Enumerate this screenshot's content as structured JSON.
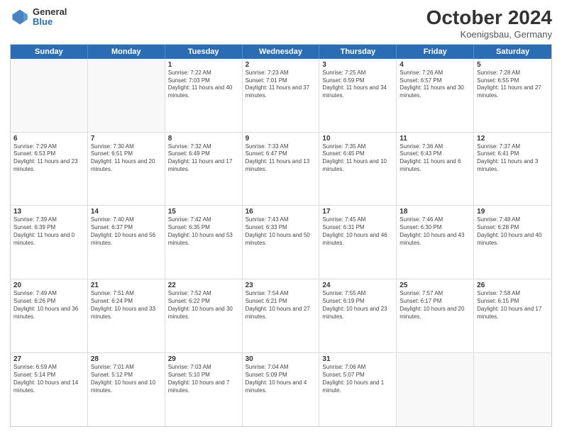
{
  "header": {
    "logo_general": "General",
    "logo_blue": "Blue",
    "month": "October 2024",
    "location": "Koenigsbau, Germany"
  },
  "days_of_week": [
    "Sunday",
    "Monday",
    "Tuesday",
    "Wednesday",
    "Thursday",
    "Friday",
    "Saturday"
  ],
  "rows": [
    [
      {
        "day": "",
        "text": "",
        "empty": true
      },
      {
        "day": "",
        "text": "",
        "empty": true
      },
      {
        "day": "1",
        "text": "Sunrise: 7:22 AM\nSunset: 7:03 PM\nDaylight: 11 hours and 40 minutes."
      },
      {
        "day": "2",
        "text": "Sunrise: 7:23 AM\nSunset: 7:01 PM\nDaylight: 11 hours and 37 minutes."
      },
      {
        "day": "3",
        "text": "Sunrise: 7:25 AM\nSunset: 6:59 PM\nDaylight: 11 hours and 34 minutes."
      },
      {
        "day": "4",
        "text": "Sunrise: 7:26 AM\nSunset: 6:57 PM\nDaylight: 11 hours and 30 minutes."
      },
      {
        "day": "5",
        "text": "Sunrise: 7:28 AM\nSunset: 6:55 PM\nDaylight: 11 hours and 27 minutes."
      }
    ],
    [
      {
        "day": "6",
        "text": "Sunrise: 7:29 AM\nSunset: 6:53 PM\nDaylight: 11 hours and 23 minutes."
      },
      {
        "day": "7",
        "text": "Sunrise: 7:30 AM\nSunset: 6:51 PM\nDaylight: 11 hours and 20 minutes."
      },
      {
        "day": "8",
        "text": "Sunrise: 7:32 AM\nSunset: 6:49 PM\nDaylight: 11 hours and 17 minutes."
      },
      {
        "day": "9",
        "text": "Sunrise: 7:33 AM\nSunset: 6:47 PM\nDaylight: 11 hours and 13 minutes."
      },
      {
        "day": "10",
        "text": "Sunrise: 7:35 AM\nSunset: 6:45 PM\nDaylight: 11 hours and 10 minutes."
      },
      {
        "day": "11",
        "text": "Sunrise: 7:36 AM\nSunset: 6:43 PM\nDaylight: 11 hours and 6 minutes."
      },
      {
        "day": "12",
        "text": "Sunrise: 7:37 AM\nSunset: 6:41 PM\nDaylight: 11 hours and 3 minutes."
      }
    ],
    [
      {
        "day": "13",
        "text": "Sunrise: 7:39 AM\nSunset: 6:39 PM\nDaylight: 11 hours and 0 minutes."
      },
      {
        "day": "14",
        "text": "Sunrise: 7:40 AM\nSunset: 6:37 PM\nDaylight: 10 hours and 56 minutes."
      },
      {
        "day": "15",
        "text": "Sunrise: 7:42 AM\nSunset: 6:35 PM\nDaylight: 10 hours and 53 minutes."
      },
      {
        "day": "16",
        "text": "Sunrise: 7:43 AM\nSunset: 6:33 PM\nDaylight: 10 hours and 50 minutes."
      },
      {
        "day": "17",
        "text": "Sunrise: 7:45 AM\nSunset: 6:31 PM\nDaylight: 10 hours and 46 minutes."
      },
      {
        "day": "18",
        "text": "Sunrise: 7:46 AM\nSunset: 6:30 PM\nDaylight: 10 hours and 43 minutes."
      },
      {
        "day": "19",
        "text": "Sunrise: 7:48 AM\nSunset: 6:28 PM\nDaylight: 10 hours and 40 minutes."
      }
    ],
    [
      {
        "day": "20",
        "text": "Sunrise: 7:49 AM\nSunset: 6:26 PM\nDaylight: 10 hours and 36 minutes."
      },
      {
        "day": "21",
        "text": "Sunrise: 7:51 AM\nSunset: 6:24 PM\nDaylight: 10 hours and 33 minutes."
      },
      {
        "day": "22",
        "text": "Sunrise: 7:52 AM\nSunset: 6:22 PM\nDaylight: 10 hours and 30 minutes."
      },
      {
        "day": "23",
        "text": "Sunrise: 7:54 AM\nSunset: 6:21 PM\nDaylight: 10 hours and 27 minutes."
      },
      {
        "day": "24",
        "text": "Sunrise: 7:55 AM\nSunset: 6:19 PM\nDaylight: 10 hours and 23 minutes."
      },
      {
        "day": "25",
        "text": "Sunrise: 7:57 AM\nSunset: 6:17 PM\nDaylight: 10 hours and 20 minutes."
      },
      {
        "day": "26",
        "text": "Sunrise: 7:58 AM\nSunset: 6:15 PM\nDaylight: 10 hours and 17 minutes."
      }
    ],
    [
      {
        "day": "27",
        "text": "Sunrise: 6:59 AM\nSunset: 5:14 PM\nDaylight: 10 hours and 14 minutes."
      },
      {
        "day": "28",
        "text": "Sunrise: 7:01 AM\nSunset: 5:12 PM\nDaylight: 10 hours and 10 minutes."
      },
      {
        "day": "29",
        "text": "Sunrise: 7:03 AM\nSunset: 5:10 PM\nDaylight: 10 hours and 7 minutes."
      },
      {
        "day": "30",
        "text": "Sunrise: 7:04 AM\nSunset: 5:09 PM\nDaylight: 10 hours and 4 minutes."
      },
      {
        "day": "31",
        "text": "Sunrise: 7:06 AM\nSunset: 5:07 PM\nDaylight: 10 hours and 1 minute."
      },
      {
        "day": "",
        "text": "",
        "empty": true
      },
      {
        "day": "",
        "text": "",
        "empty": true
      }
    ]
  ]
}
